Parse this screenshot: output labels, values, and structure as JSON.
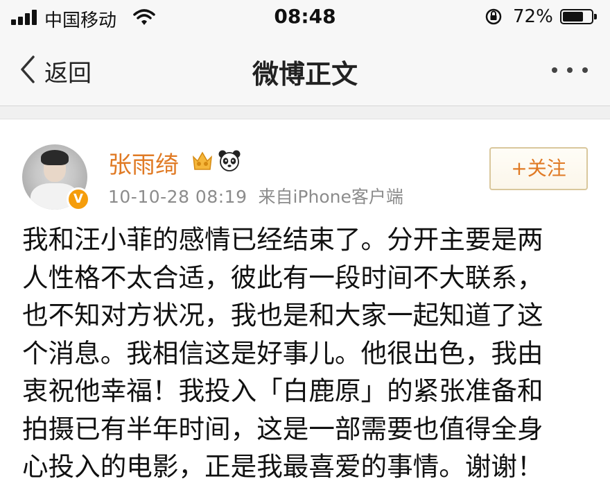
{
  "status_bar": {
    "carrier": "中国移动",
    "time": "08:48",
    "battery_percent": "72%",
    "battery_level": 0.72,
    "icons": [
      "signal-icon",
      "wifi-icon",
      "orientation-lock-icon",
      "battery-icon"
    ]
  },
  "nav": {
    "back_label": "返回",
    "title": "微博正文",
    "more_icon": "more-icon"
  },
  "post": {
    "username": "张雨绮",
    "badge_icons": [
      "vip-crown-icon",
      "panda-icon"
    ],
    "verified_mark": "V",
    "timestamp": "10-10-28 08:19",
    "source": "来自iPhone客户端",
    "follow_label": "+关注",
    "text_lines": [
      "我和汪小菲的感情已经结束了。分开主要是两",
      "人性格不太合适，彼此有一段时间不大联系，",
      "也不知对方状况，我也是和大家一起知道了这",
      "个消息。我相信这是好事儿。他很出色，我由",
      "衷祝他幸福！我投入「白鹿原」的紧张准备和",
      "拍摄已有半年时间，这是一部需要也值得全身",
      "心投入的电影，正是我最喜爱的事情。谢谢！"
    ]
  },
  "colors": {
    "accent": "#e07a24",
    "meta_text": "#8c8c8c",
    "bar_bg": "#f7f7f7",
    "verified_badge": "#f59d0c"
  }
}
